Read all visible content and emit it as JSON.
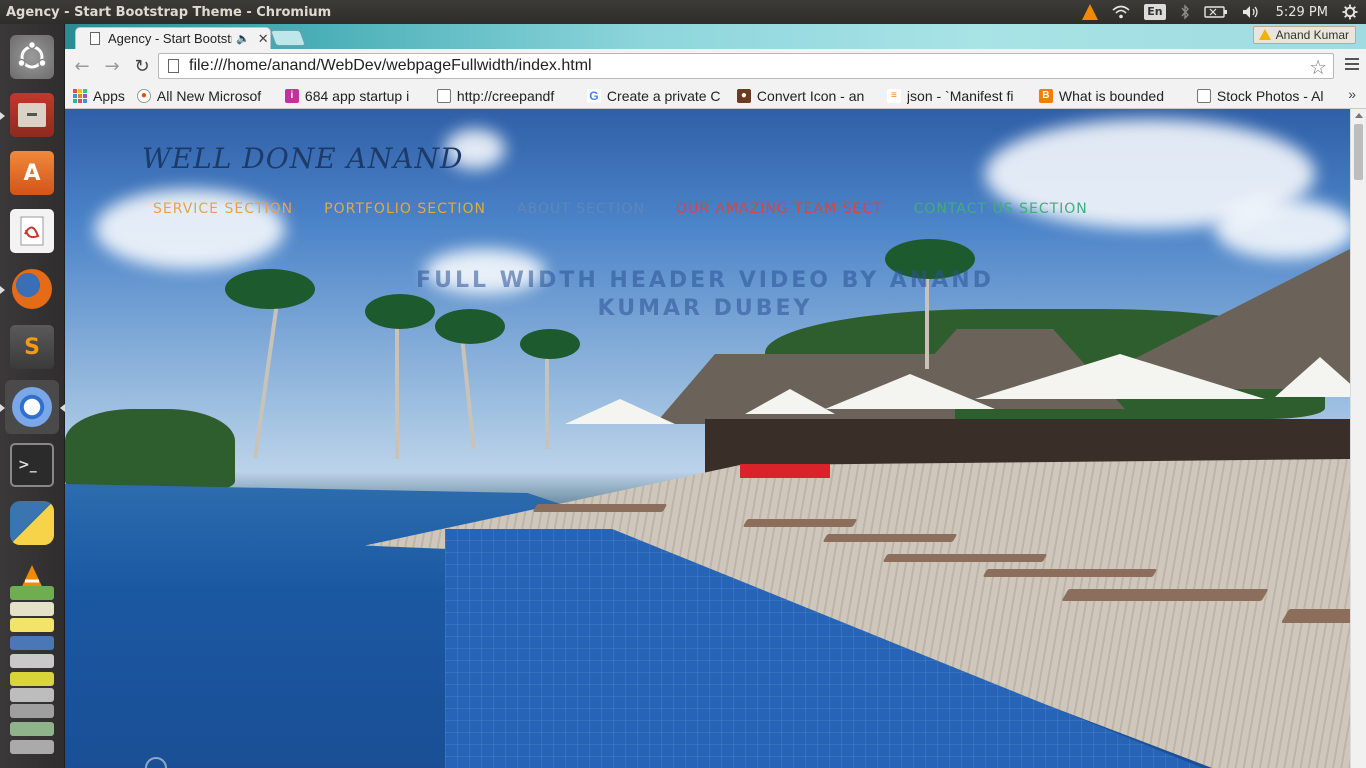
{
  "desktop": {
    "window_title": "Agency - Start Bootstrap Theme - Chromium",
    "keyboard_layout": "En",
    "clock": "5:29 PM"
  },
  "browser": {
    "tab": {
      "title": "Agency - Start Bootstrap Theme"
    },
    "profile_name": "Anand Kumar",
    "url": "file:///home/anand/WebDev/webpageFullwidth/index.html",
    "bookmarks": [
      {
        "label": "Apps",
        "icon": "apps-grid-icon"
      },
      {
        "label": "All New Microsof",
        "icon": "reddit-icon"
      },
      {
        "label": "684 app startup i",
        "icon": "startup-icon"
      },
      {
        "label": "http://creepandf",
        "icon": "page-icon"
      },
      {
        "label": "Create a private C",
        "icon": "google-icon"
      },
      {
        "label": "Convert Icon - an",
        "icon": "convert-icon"
      },
      {
        "label": "json - `Manifest fi",
        "icon": "stackoverflow-icon"
      },
      {
        "label": "What is bounded",
        "icon": "blogger-icon"
      },
      {
        "label": "Stock Photos - Al",
        "icon": "page-icon"
      }
    ],
    "more_bookmarks": "»"
  },
  "page": {
    "brand": "WELL DONE ANAND",
    "nav": [
      {
        "label": "SERVICE SECTION",
        "color": "#e8a24a"
      },
      {
        "label": "PORTFOLIO SECTION",
        "color": "#e6a93a"
      },
      {
        "label": "ABOUT SECTION",
        "color": "#5c87b8"
      },
      {
        "label": "OUR AMAZING TEAM SECT",
        "color": "#d9463e"
      },
      {
        "label": "CONTACT US SECTION",
        "color": "#3fae7a"
      }
    ],
    "hero_line1": "FULL WIDTH HEADER VIDEO BY ANAND",
    "hero_line2": "KUMAR DUBEY"
  }
}
